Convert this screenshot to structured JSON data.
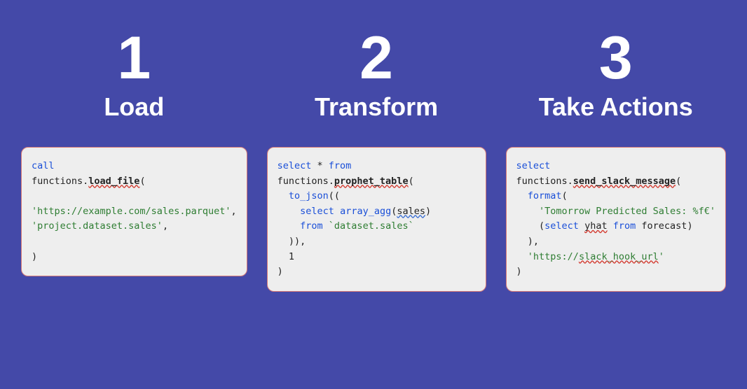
{
  "steps": [
    {
      "number": "1",
      "title": "Load",
      "code": {
        "l1_kw": "call",
        "l2_prefix": "functions.",
        "l2_fn": "load_file",
        "l2_suffix": "(",
        "blank1": "",
        "l3_url": "'https://example.com/sales.parquet'",
        "l3_comma": ",",
        "l4_target": "'project.dataset.sales'",
        "l4_comma": ",",
        "blank2": "",
        "l5_close": ")"
      }
    },
    {
      "number": "2",
      "title": "Transform",
      "code": {
        "l1_kw": "select",
        "l1_star": " * ",
        "l1_from": "from",
        "l2_prefix": "functions.",
        "l2_fn": "prophet_table",
        "l2_suffix": "(",
        "l3_indent": "  ",
        "l3_tojson": "to_json",
        "l3_paren": "((",
        "l4_indent": "    ",
        "l4_select": "select",
        "l4_sp": " ",
        "l4_agg": "array_agg",
        "l4_open": "(",
        "l4_col": "sales",
        "l4_close": ")",
        "l5_indent": "    ",
        "l5_from": "from",
        "l5_sp": " ",
        "l5_tbl": "`dataset.sales`",
        "l6_indent": "  ",
        "l6_close": ")),",
        "l7_indent": "  ",
        "l7_one": "1",
        "l8_close": ")"
      }
    },
    {
      "number": "3",
      "title": "Take Actions",
      "code": {
        "l1_kw": "select",
        "l2_prefix": "functions.",
        "l2_fn": "send_slack_message",
        "l2_suffix": "(",
        "l3_indent": "  ",
        "l3_format": "format",
        "l3_paren": "(",
        "l4_indent": "    ",
        "l4_str": "'Tomorrow Predicted Sales: %f€'",
        "l5_indent": "    ",
        "l5_open": "(",
        "l5_select": "select",
        "l5_sp1": " ",
        "l5_yhat": "yhat",
        "l5_sp2": " ",
        "l5_from": "from",
        "l5_sp3": " ",
        "l5_fore": "forecast",
        "l5_close": ")",
        "l6_indent": "  ",
        "l6_close": "),",
        "l7_indent": "  ",
        "l7_url_q1": "'https://",
        "l7_url_mid": "slack_hook_url",
        "l7_url_q2": "'",
        "l8_close": ")"
      }
    }
  ]
}
